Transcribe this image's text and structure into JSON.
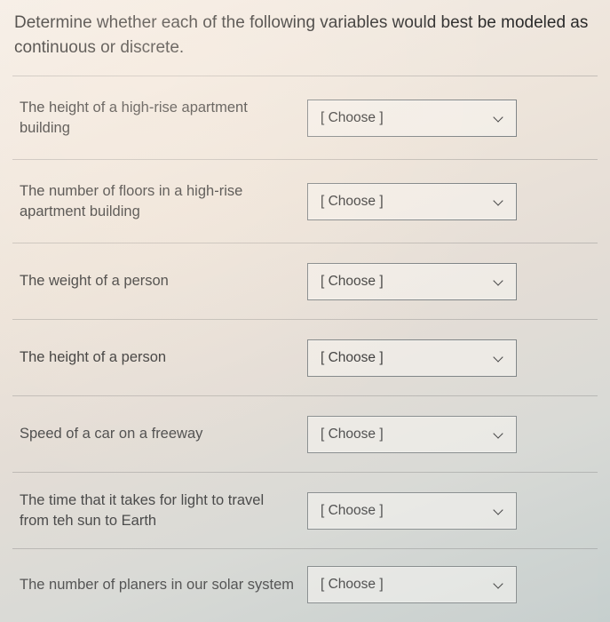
{
  "prompt": "Determine whether each of the following variables would best be modeled as continuous or discrete.",
  "placeholder": "[ Choose ]",
  "rows": [
    {
      "label": "The height of a high-rise apartment building"
    },
    {
      "label": "The number of floors in a high-rise apartment building"
    },
    {
      "label": "The weight of a person"
    },
    {
      "label": "The height of a person"
    },
    {
      "label": "Speed of a car on a freeway"
    },
    {
      "label": "The time that it takes for light to travel from teh sun to Earth"
    },
    {
      "label": "The number of planers in our solar system"
    }
  ]
}
